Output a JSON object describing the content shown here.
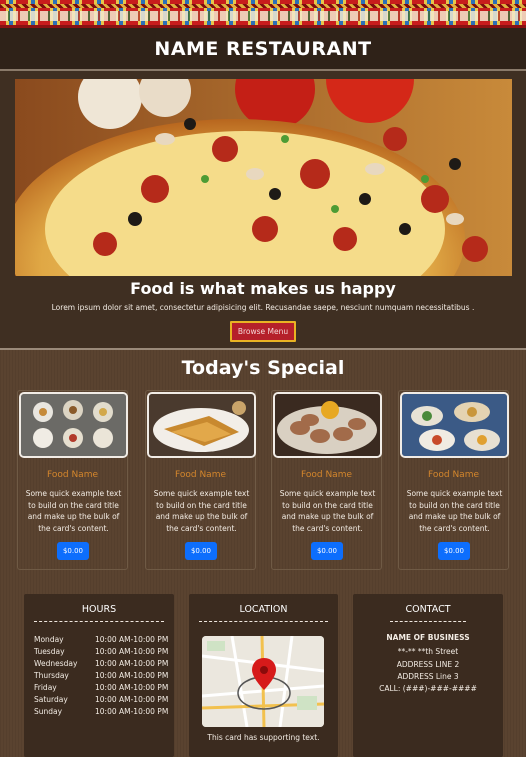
{
  "header": {
    "title": "NAME RESTAURANT"
  },
  "hero": {
    "image_icon": "pizza-photo",
    "heading": "Food is what makes us happy",
    "text": "Lorem ipsum dolor sit amet, consectetur adipisicing elit. Recusandae saepe, nesciunt numquam necessitatibus .",
    "button_label": "Browse Menu"
  },
  "special": {
    "title": "Today's Special",
    "cards": [
      {
        "image_icon": "dumplings-platter-photo",
        "name": "Food Name",
        "text": "Some quick example text to build on the card title and make up the bulk of the card's content.",
        "price": "$0.00"
      },
      {
        "image_icon": "fried-bread-photo",
        "name": "Food Name",
        "text": "Some quick example text to build on the card title and make up the bulk of the card's content.",
        "price": "$0.00"
      },
      {
        "image_icon": "momo-dumplings-photo",
        "name": "Food Name",
        "text": "Some quick example text to build on the card title and make up the bulk of the card's content.",
        "price": "$0.00"
      },
      {
        "image_icon": "buffet-spread-photo",
        "name": "Food Name",
        "text": "Some quick example text to build on the card title and make up the bulk of the card's content.",
        "price": "$0.00"
      }
    ]
  },
  "hours": {
    "title": "HOURS",
    "rows": [
      {
        "day": "Monday",
        "time": "10:00 AM-10:00 PM"
      },
      {
        "day": "Tuesday",
        "time": "10:00 AM-10:00 PM"
      },
      {
        "day": "Wednesday",
        "time": "10:00 AM-10:00 PM"
      },
      {
        "day": "Thursday",
        "time": "10:00 AM-10:00 PM"
      },
      {
        "day": "Friday",
        "time": "10:00 AM-10:00 PM"
      },
      {
        "day": "Saturday",
        "time": "10:00 AM-10:00 PM"
      },
      {
        "day": "Sunday",
        "time": "10:00 AM-10:00 PM"
      }
    ]
  },
  "location": {
    "title": "LOCATION",
    "map_icon": "map-pin-icon",
    "caption": "This card has supporting text."
  },
  "contact": {
    "title": "CONTACT",
    "business_name": "NAME OF BUSINESS",
    "street": "**-** **th Street",
    "address2": "ADDRESS LINE 2",
    "address3": "ADDRESS Line 3",
    "phone": "CALL: (###)-###-####"
  },
  "colors": {
    "accent": "#0d6efd",
    "food_name": "#d4862c",
    "browse_button": "#b5202a"
  }
}
